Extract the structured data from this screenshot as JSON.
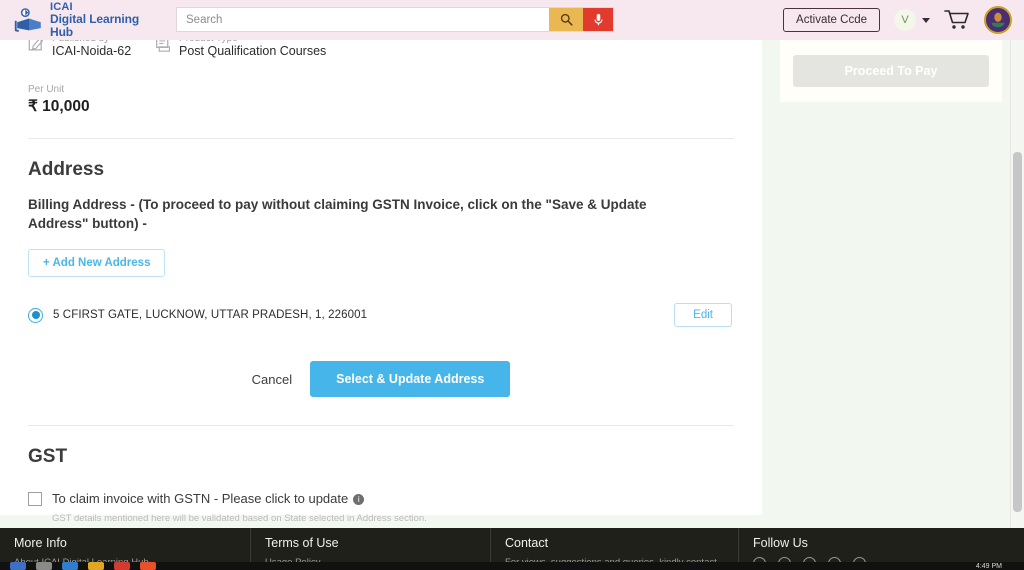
{
  "header": {
    "brand_line1": "ICAI",
    "brand_line2": "Digital Learning Hub",
    "search_placeholder": "Search",
    "search_value": "",
    "activate_code_label": "Activate Ccde",
    "avatar_letter": "V",
    "icons": {
      "logo": "icai-logo-icon",
      "search": "search-icon",
      "mic": "microphone-icon",
      "cart": "shopping-cart-icon",
      "emblem": "icai-emblem-icon",
      "caret": "chevron-down-icon"
    }
  },
  "product": {
    "published_by_label": "Published by",
    "published_by_value": "ICAI-Noida-62",
    "product_type_label": "Product Type",
    "product_type_value": "Post Qualification Courses",
    "per_unit_label": "Per Unit",
    "per_unit_value": "₹ 10,000"
  },
  "address": {
    "section_title": "Address",
    "billing_note": "Billing Address - (To proceed to pay without claiming GSTN Invoice, click on the \"Save & Update Address\" button) -",
    "add_new_label": "+ Add New Address",
    "entries": [
      {
        "text": "5 CFIRST GATE, LUCKNOW, UTTAR PRADESH, 1, 226001",
        "selected": true,
        "edit_label": "Edit"
      }
    ],
    "cancel_label": "Cancel",
    "select_update_label": "Select & Update Address"
  },
  "gst": {
    "section_title": "GST",
    "checkbox_label": "To claim invoice with GSTN - Please click to update",
    "checked": false,
    "info_glyph": "i",
    "hint": "GST details mentioned here will be validated based on State selected in Address section."
  },
  "sidebar": {
    "proceed_label": "Proceed To Pay",
    "proceed_disabled": true
  },
  "footer": {
    "columns": [
      {
        "title": "More Info",
        "sub": "About ICAI Digital Learning Hub"
      },
      {
        "title": "Terms of Use",
        "sub": "Usage Policy"
      },
      {
        "title": "Contact",
        "sub": "For views, suggestions and queries, kindly contact"
      },
      {
        "title": "Follow Us",
        "sub": ""
      }
    ]
  },
  "taskbar": {
    "time": "4:49 PM"
  },
  "colors": {
    "header_bg": "#f6e8ee",
    "brand_blue": "#2f5fa8",
    "accent_blue": "#46b5ea",
    "search_btn": "#eab852",
    "mic_btn": "#e23b2e",
    "page_bg": "#f2f8f0",
    "footer_bg": "#1e2019"
  }
}
